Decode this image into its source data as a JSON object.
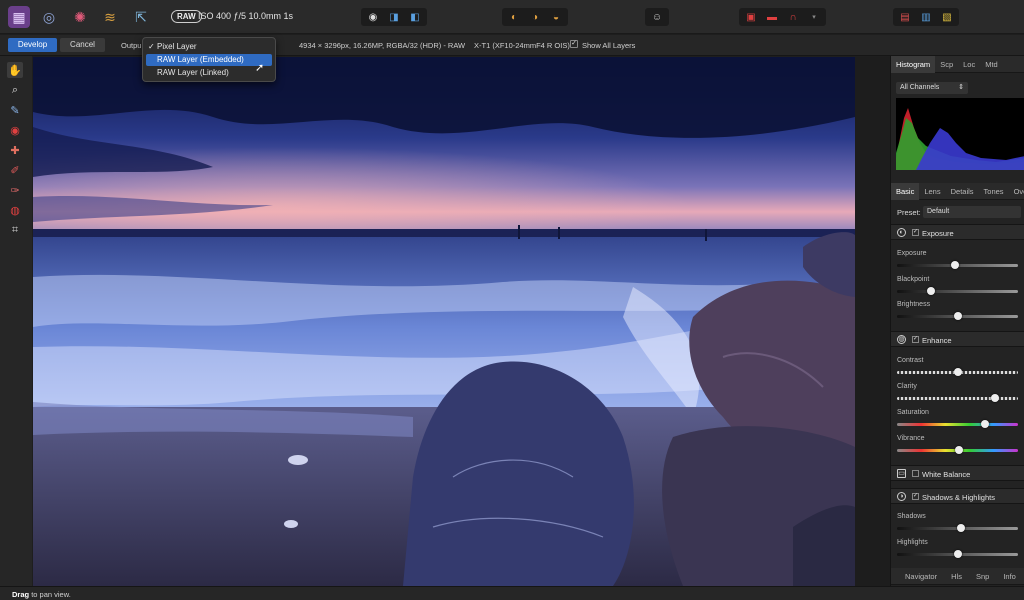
{
  "toolbar": {
    "personas": [
      "photo-persona-icon",
      "liquify-persona-icon",
      "develop-persona-icon",
      "tone-mapping-persona-icon",
      "export-persona-icon"
    ],
    "raw_badge": "RAW",
    "raw_info": "ISO 400 ƒ/5 10.0mm 1s"
  },
  "context": {
    "develop": "Develop",
    "cancel": "Cancel",
    "output_label": "Outpu",
    "image_info": "4934 × 3296px, 16.26MP, RGBA/32 (HDR) - RAW",
    "lens_info": "X-T1 (XF10-24mmF4 R OIS)",
    "show_all_layers": "Show All Layers"
  },
  "dropdown": {
    "items": [
      {
        "label": "Pixel Layer",
        "checked": true
      },
      {
        "label": "RAW Layer (Embedded)",
        "selected": true
      },
      {
        "label": "RAW Layer (Linked)"
      }
    ]
  },
  "panel": {
    "top_tabs": [
      "Histogram",
      "Scp",
      "Loc",
      "Mtd"
    ],
    "channels": "All Channels",
    "dev_tabs": [
      "Basic",
      "Lens",
      "Details",
      "Tones",
      "Ove"
    ],
    "preset_label": "Preset:",
    "preset_value": "Default",
    "exposure": {
      "title": "Exposure",
      "sliders": [
        {
          "label": "Exposure",
          "value": 0.48
        },
        {
          "label": "Blackpoint",
          "value": 0.28
        },
        {
          "label": "Brightness",
          "value": 0.5
        }
      ]
    },
    "enhance": {
      "title": "Enhance",
      "sliders": [
        {
          "label": "Contrast",
          "value": 0.5
        },
        {
          "label": "Clarity",
          "value": 0.81
        },
        {
          "label": "Saturation",
          "value": 0.73
        },
        {
          "label": "Vibrance",
          "value": 0.51
        }
      ]
    },
    "white_balance": {
      "title": "White Balance"
    },
    "shadows_highlights": {
      "title": "Shadows & Highlights",
      "sliders": [
        {
          "label": "Shadows",
          "value": 0.53
        },
        {
          "label": "Highlights",
          "value": 0.5
        }
      ]
    },
    "bottom_tabs": [
      "Navigator",
      "Hls",
      "Snp",
      "Info"
    ]
  },
  "status": {
    "action": "Drag",
    "hint": "to pan view."
  },
  "colors": {
    "accent": "#2f6bc2",
    "histogram_red": "#c0202a",
    "histogram_green": "#2fa02f",
    "histogram_blue": "#3a3ad0"
  }
}
